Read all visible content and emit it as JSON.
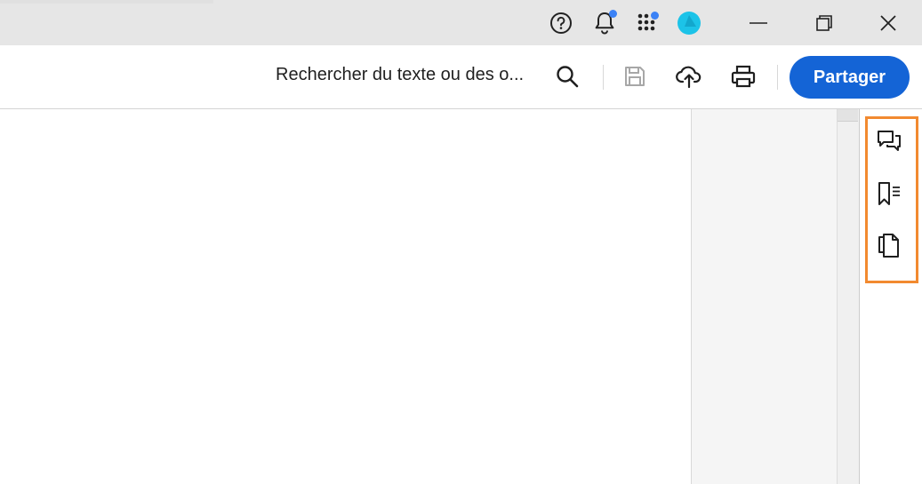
{
  "titlebar": {
    "icons": [
      "help-icon",
      "notifications-icon",
      "apps-icon",
      "account-avatar-icon"
    ],
    "window_controls": [
      "minimize-icon",
      "restore-icon",
      "close-icon"
    ],
    "colors": {
      "background": "#e6e6e6",
      "notification_dot": "#3b82f6",
      "avatar": "#1cc3e8"
    }
  },
  "toolbar": {
    "search_label": "Rechercher du texte ou des o...",
    "icons": [
      "search-icon",
      "save-icon",
      "upload-cloud-icon",
      "print-icon"
    ],
    "share_label": "Partager",
    "colors": {
      "share_button": "#1464d6"
    }
  },
  "right_panel": {
    "icons": [
      "comments-icon",
      "bookmarks-icon",
      "pages-icon"
    ],
    "highlight_color": "#f28a30"
  }
}
